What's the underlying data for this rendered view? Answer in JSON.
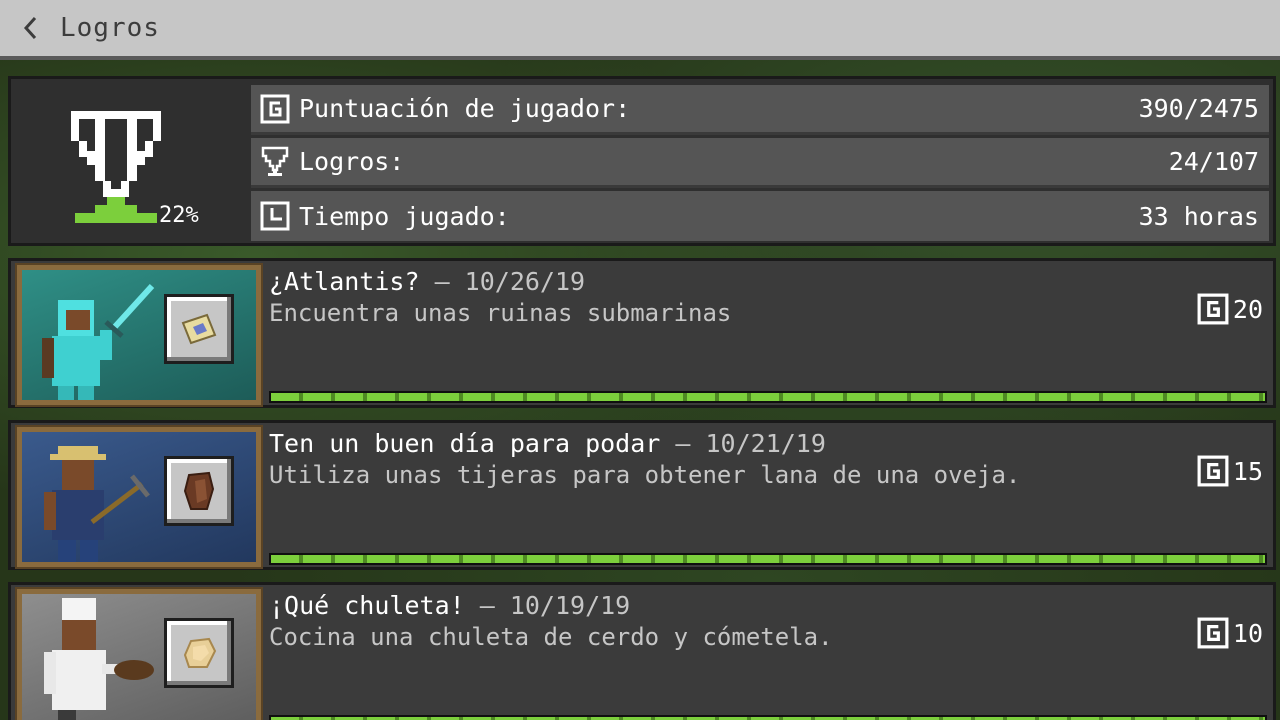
{
  "header": {
    "back_label": "<",
    "title": "Logros"
  },
  "summary": {
    "percent": "22%",
    "stats": [
      {
        "icon": "gamerscore-icon",
        "label": "Puntuación de jugador:",
        "value": "390/2475"
      },
      {
        "icon": "trophy-icon",
        "label": "Logros:",
        "value": "24/107"
      },
      {
        "icon": "clock-icon",
        "label": "Tiempo jugado:",
        "value": "33 horas"
      }
    ]
  },
  "achievements": [
    {
      "title": "¿Atlantis?",
      "date": " – 10/26/19",
      "description": "Encuentra unas ruinas submarinas",
      "score": "20",
      "progress": 1.0,
      "item_icon": "map-icon"
    },
    {
      "title": "Ten un buen día para podar",
      "date": " – 10/21/19",
      "description": "Utiliza unas tijeras para obtener lana de una oveja.",
      "score": "15",
      "progress": 1.0,
      "item_icon": "leather-icon"
    },
    {
      "title": "¡Qué chuleta!",
      "date": " – 10/19/19",
      "description": "Cocina una chuleta de cerdo y cómetela.",
      "score": "10",
      "progress": 1.0,
      "item_icon": "porkchop-icon"
    }
  ],
  "colors": {
    "progress_green": "#7ccf3c",
    "header_bg": "#c6c6c6",
    "panel_bg": "#2f2f2f"
  }
}
